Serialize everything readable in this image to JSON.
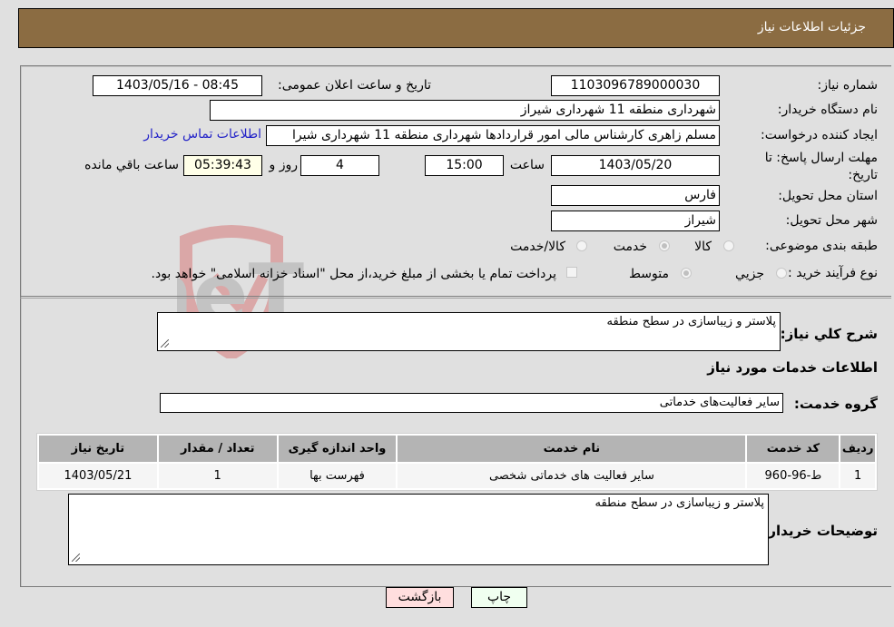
{
  "header": {
    "title": "جزئیات اطلاعات نیاز"
  },
  "form": {
    "need_number": {
      "label": "شماره نیاز:",
      "value": "1103096789000030"
    },
    "announce_datetime": {
      "label": "تاریخ و ساعت اعلان عمومی:",
      "value": "1403/05/16 - 08:45"
    },
    "buyer_org": {
      "label": "نام دستگاه خریدار:",
      "value": "شهرداری منطقه 11 شهرداری شیراز"
    },
    "requester": {
      "label": "ایجاد کننده درخواست:",
      "value": "مسلم زاهری کارشناس مالی امور قراردادها شهرداری منطقه 11 شهرداری شیرا"
    },
    "buyer_contact_link": "اطلاعات تماس خریدار",
    "deadline": {
      "label": "مهلت ارسال پاسخ: تا تاریخ:",
      "date": "1403/05/20",
      "time_label": "ساعت",
      "time": "15:00",
      "days": "4",
      "days_label": "روز و",
      "remaining": "05:39:43",
      "remaining_label": "ساعت باقي مانده"
    },
    "province": {
      "label": "استان محل تحویل:",
      "value": "فارس"
    },
    "city": {
      "label": "شهر محل تحویل:",
      "value": "شیراز"
    },
    "category": {
      "label": "طبقه بندی موضوعی:",
      "options": [
        {
          "label": "کالا",
          "checked": false
        },
        {
          "label": "خدمت",
          "checked": true
        },
        {
          "label": "کالا/خدمت",
          "checked": false
        }
      ]
    },
    "purchase_type": {
      "label": "نوع فرآیند خرید :",
      "options": [
        {
          "label": "جزيي",
          "checked": false
        },
        {
          "label": "متوسط",
          "checked": true
        }
      ],
      "checkbox_text": "پرداخت تمام یا بخشی از مبلغ خرید،از محل \"اسناد خزانه اسلامی\" خواهد بود.",
      "checkbox_checked": false
    },
    "description": {
      "label": "شرح کلي نیاز:",
      "value": "پلاستر و زیباسازی در سطح منطقه"
    },
    "services_heading": "اطلاعات خدمات مورد نیاز",
    "service_group": {
      "label": "گروه خدمت:",
      "value": "سایر فعالیت‌های خدماتی"
    }
  },
  "table": {
    "headers": [
      "ردیف",
      "کد خدمت",
      "نام خدمت",
      "واحد اندازه گیری",
      "تعداد / مقدار",
      "تاریخ نیاز"
    ],
    "rows": [
      [
        "1",
        "ط-96-960",
        "سایر فعالیت های خدماتی شخصی",
        "فهرست بها",
        "1",
        "1403/05/21"
      ]
    ]
  },
  "buyer_notes": {
    "label": "توضیحات خریدار:",
    "value": "پلاستر و زیباسازی در سطح منطقه"
  },
  "buttons": {
    "print": "چاپ",
    "back": "بازگشت"
  },
  "watermark": "AriaTender.neT"
}
